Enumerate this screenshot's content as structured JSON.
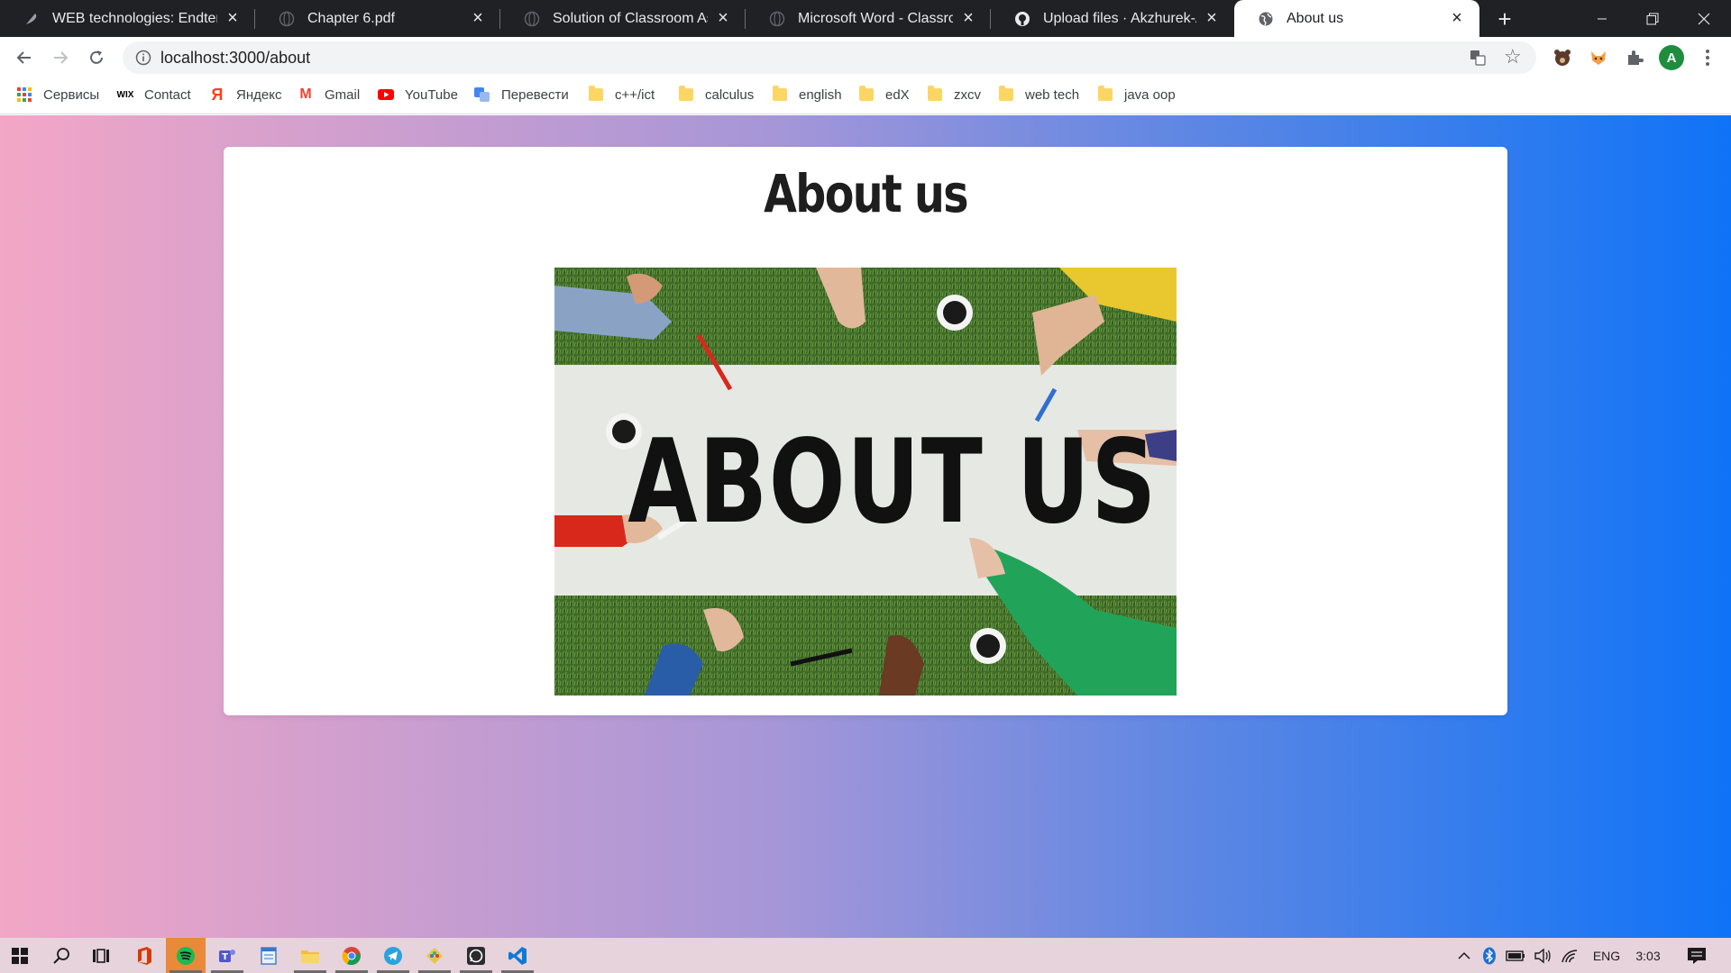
{
  "browser": {
    "tabs": [
      {
        "title": "WEB technologies: Endterm",
        "icon": "feather-icon",
        "active": false
      },
      {
        "title": "Chapter 6.pdf",
        "icon": "globe-icon",
        "active": false
      },
      {
        "title": "Solution of Classroom Assign",
        "icon": "globe-icon",
        "active": false
      },
      {
        "title": "Microsoft Word - Classroom",
        "icon": "globe-icon",
        "active": false
      },
      {
        "title": "Upload files · Akzhurek-A/En",
        "icon": "github-icon",
        "active": false
      },
      {
        "title": "About us",
        "icon": "globe-icon",
        "active": true
      }
    ],
    "close_glyph": "×",
    "new_tab_glyph": "+",
    "address": {
      "url": "localhost:3000/about"
    },
    "profile_initial": "A",
    "bookmarks": [
      {
        "label": "Сервисы",
        "icon": "apps-grid-icon"
      },
      {
        "label": "Contact",
        "icon": "wix-icon"
      },
      {
        "label": "Яндекс",
        "icon": "yandex-icon"
      },
      {
        "label": "Gmail",
        "icon": "gmail-icon"
      },
      {
        "label": "YouTube",
        "icon": "youtube-icon"
      },
      {
        "label": "Перевести",
        "icon": "translate-icon"
      },
      {
        "label": "c++/ict",
        "icon": "folder-icon"
      },
      {
        "label": "calculus",
        "icon": "folder-icon"
      },
      {
        "label": "english",
        "icon": "folder-icon"
      },
      {
        "label": "edX",
        "icon": "folder-icon"
      },
      {
        "label": "zxcv",
        "icon": "folder-icon"
      },
      {
        "label": "web tech",
        "icon": "folder-icon"
      },
      {
        "label": "java oop",
        "icon": "folder-icon"
      }
    ],
    "wix_label": "WIX",
    "yandex_glyph": "Я",
    "gmail_glyph": "M"
  },
  "page": {
    "heading": "About us",
    "hero_image_text": "ABOUT US",
    "gradient": {
      "start": "#f3a6c6",
      "end": "#0f73f7"
    }
  },
  "taskbar": {
    "apps": [
      "windows-start-icon",
      "search-icon",
      "task-view-icon",
      "office-icon",
      "spotify-icon",
      "teams-icon",
      "notepad-icon",
      "file-explorer-icon",
      "chrome-icon",
      "telegram-icon",
      "paint-icon",
      "whatsapp-icon",
      "vscode-icon"
    ],
    "language": "ENG",
    "time": "3:03"
  }
}
